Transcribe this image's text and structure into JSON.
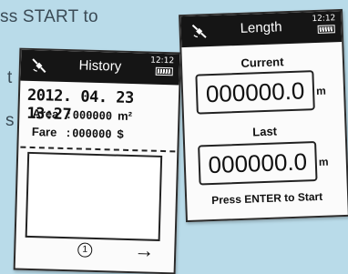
{
  "background_text": {
    "line1": "ss START to",
    "line2": "t",
    "line3": "s"
  },
  "history": {
    "title": "History",
    "time": "12:12",
    "date": "2012. 04. 23  13:27",
    "area_label": "Area",
    "area_value": "000000",
    "area_unit": "m²",
    "fare_label": "Fare",
    "fare_value": "000000",
    "fare_unit": "$",
    "page_number": "1",
    "next_arrow": "→"
  },
  "length": {
    "title": "Length",
    "time": "12:12",
    "current_label": "Current",
    "current_value": "000000.0",
    "current_unit": "m",
    "last_label": "Last",
    "last_value": "000000.0",
    "last_unit": "m",
    "prompt": "Press ENTER to Start"
  },
  "colors": {
    "background": "#b9dbe9",
    "screen": "#fbfbfb",
    "topbar": "#151515"
  },
  "icons": [
    "satellite-icon",
    "battery-icon",
    "arrow-right-icon"
  ]
}
